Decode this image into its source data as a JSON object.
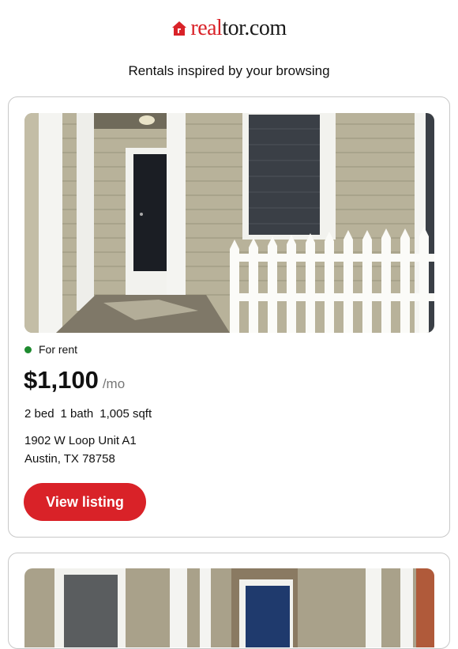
{
  "brand": {
    "logo_real": "real",
    "logo_tor": "tor.com",
    "color": "#d92228"
  },
  "intro": "Rentals inspired by your browsing",
  "listings": [
    {
      "status": "For rent",
      "status_color": "#1e8a2f",
      "price": "$1,100",
      "price_unit": "/mo",
      "beds": "2 bed",
      "baths": "1 bath",
      "sqft": "1,005 sqft",
      "address_line1": "1902 W Loop Unit A1",
      "address_line2": "Austin, TX 78758",
      "cta": "View listing"
    }
  ],
  "icons": [
    "realtor-house-icon"
  ]
}
